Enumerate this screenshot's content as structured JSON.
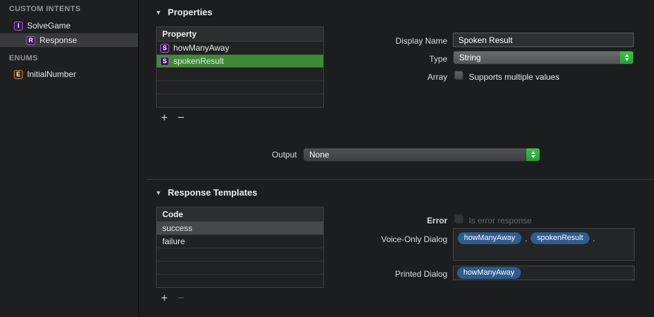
{
  "sidebar": {
    "custom_intents_title": "CUSTOM INTENTS",
    "enums_title": "ENUMS",
    "solve_game": {
      "badge": "I",
      "label": "SolveGame"
    },
    "response": {
      "badge": "R",
      "label": "Response"
    },
    "initial_number": {
      "badge": "E",
      "label": "InitialNumber"
    }
  },
  "properties": {
    "title": "Properties",
    "disclosure": "▼",
    "table": {
      "header": "Property",
      "rows": [
        {
          "badge": "S",
          "name": "howManyAway"
        },
        {
          "badge": "S",
          "name": "spokenResult"
        }
      ]
    },
    "add_button": "+",
    "remove_button": "−",
    "display_name": {
      "label": "Display Name",
      "value": "Spoken Result"
    },
    "type": {
      "label": "Type",
      "value": "String"
    },
    "array": {
      "label": "Array",
      "checkbox_label": "Supports multiple values"
    },
    "output": {
      "label": "Output",
      "value": "None"
    }
  },
  "response_templates": {
    "title": "Response Templates",
    "disclosure": "▼",
    "table": {
      "header": "Code",
      "rows": [
        {
          "code": "success"
        },
        {
          "code": "failure"
        }
      ]
    },
    "add_button": "+",
    "remove_button": "−",
    "error": {
      "label": "Error",
      "checkbox_label": "Is error response"
    },
    "voice_only_dialog": {
      "label": "Voice-Only Dialog",
      "tokens": [
        {
          "kind": "pill",
          "text": "howManyAway"
        },
        {
          "kind": "text",
          "text": "."
        },
        {
          "kind": "pill",
          "text": "spokenResult"
        },
        {
          "kind": "text",
          "text": "."
        }
      ]
    },
    "printed_dialog": {
      "label": "Printed Dialog",
      "tokens": [
        {
          "kind": "pill",
          "text": "howManyAway"
        }
      ]
    }
  },
  "colors": {
    "selection_green": "#3e8b35",
    "row_selection_gray": "#48484b",
    "token_pill_blue": "#2e5c8e",
    "stepper_accent_green": "#2fb33a",
    "intent_badge_purple": "#a658d9",
    "enum_badge_orange": "#c97b2d"
  }
}
